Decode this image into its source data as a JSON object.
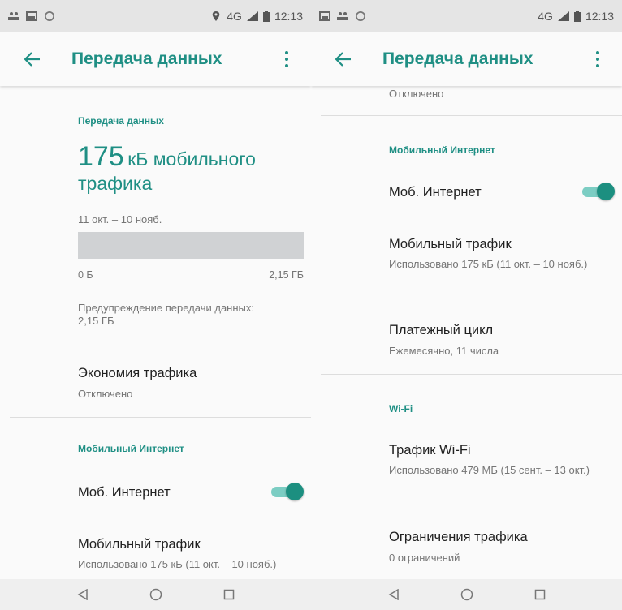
{
  "colors": {
    "accent": "#1f8f84",
    "toggle_track": "#7ccdc3",
    "toggle_thumb": "#1c8f80"
  },
  "left": {
    "status": {
      "network": "4G",
      "time": "12:13"
    },
    "title": "Передача данных",
    "usage": {
      "section_header": "Передача данных",
      "value": "175",
      "value_unit": "кБ мобильного трафика",
      "period": "11 окт. – 10 нояб.",
      "bar_min": "0 Б",
      "bar_max": "2,15 ГБ",
      "warning": "Предупреждение передачи данных: 2,15 ГБ"
    },
    "data_saver": {
      "title": "Экономия трафика",
      "summary": "Отключено"
    },
    "mobile_section_header": "Мобильный Интернет",
    "mobile_internet": {
      "label": "Моб. Интернет",
      "enabled": true
    },
    "mobile_traffic": {
      "title": "Мобильный трафик",
      "summary": "Использовано 175 кБ (11 окт. – 10 нояб.)"
    }
  },
  "right": {
    "status": {
      "network": "4G",
      "time": "12:13"
    },
    "title": "Передача данных",
    "top_summary": "Отключено",
    "mobile_section_header": "Мобильный Интернет",
    "mobile_internet": {
      "label": "Моб. Интернет",
      "enabled": true
    },
    "mobile_traffic": {
      "title": "Мобильный трафик",
      "summary": "Использовано 175 кБ (11 окт. – 10 нояб.)"
    },
    "billing_cycle": {
      "title": "Платежный цикл",
      "summary": "Ежемесячно, 11 числа"
    },
    "wifi_section_header": "Wi-Fi",
    "wifi_traffic": {
      "title": "Трафик Wi-Fi",
      "summary": "Использовано 479 МБ (15 сент. – 13 окт.)"
    },
    "restrictions": {
      "title": "Ограничения трафика",
      "summary": "0 ограничений"
    }
  },
  "icons": [
    "people-icon",
    "image-icon",
    "circle-icon",
    "location-icon",
    "signal-icon",
    "battery-icon",
    "back-arrow-icon",
    "overflow-menu-icon",
    "nav-back-icon",
    "nav-home-icon",
    "nav-recents-icon"
  ]
}
